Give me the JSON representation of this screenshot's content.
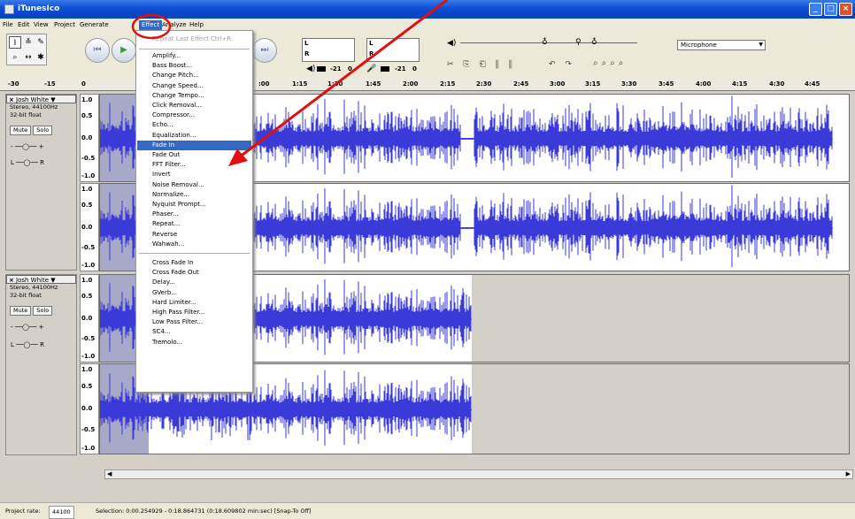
{
  "window": {
    "title": "iTunesIco"
  },
  "menubar": [
    "File",
    "Edit",
    "View",
    "Project",
    "Generate",
    "Effect",
    "Analyze",
    "Help"
  ],
  "timeline": {
    "labels": [
      "-30",
      "-15",
      "0",
      ":00",
      "1:15",
      "1:30",
      "1:45",
      "2:00",
      "2:15",
      "2:30",
      "2:45",
      "3:00",
      "3:15",
      "3:30",
      "3:45",
      "4:00",
      "4:15",
      "4:30",
      "4:45"
    ]
  },
  "meter": {
    "left_labels": [
      "L",
      "R"
    ],
    "scale": [
      "-21",
      "0",
      "-21",
      "0"
    ]
  },
  "input_device": "Microphone",
  "tracks": [
    {
      "name": "Josh White ▼",
      "info": [
        "Stereo, 44100Hz",
        "32-bit float"
      ],
      "mute": "Mute",
      "solo": "Solo",
      "gain_labels": [
        "-",
        "+"
      ],
      "pan_labels": [
        "L",
        "R"
      ]
    },
    {
      "name": "Josh White ▼",
      "info": [
        "Stereo, 44100Hz",
        "32-bit float"
      ],
      "mute": "Mute",
      "solo": "Solo",
      "gain_labels": [
        "-",
        "+"
      ],
      "pan_labels": [
        "L",
        "R"
      ]
    }
  ],
  "vruler": [
    "1.0",
    "0.5",
    "0.0",
    "-0.5",
    "-1.0"
  ],
  "effect_menu": {
    "repeat": "Repeat Last Effect  Ctrl+R",
    "group1": [
      "Amplify...",
      "Bass Boost...",
      "Change Pitch...",
      "Change Speed...",
      "Change Tempo...",
      "Click Removal...",
      "Compressor...",
      "Echo...",
      "Equalization...",
      "Fade In",
      "Fade Out",
      "FFT Filter...",
      "Invert",
      "Noise Removal...",
      "Normalize...",
      "Nyquist Prompt...",
      "Phaser...",
      "Repeat...",
      "Reverse",
      "Wahwah..."
    ],
    "group2": [
      "Cross Fade In",
      "Cross Fade Out",
      "Delay...",
      "GVerb...",
      "Hard Limiter...",
      "High Pass Filter...",
      "Low Pass Filter...",
      "SC4...",
      "Tremolo..."
    ],
    "highlighted": "Fade In"
  },
  "status": {
    "rate_label": "Project rate:",
    "rate": "44100",
    "selection": "Selection: 0:00.254929 - 0:18.864731 (0:18.609802 min:sec)  [Snap-To Off]"
  },
  "colors": {
    "waveform": "#3a3ad8",
    "annotation": "#e01010",
    "highlight": "#316ac5"
  }
}
